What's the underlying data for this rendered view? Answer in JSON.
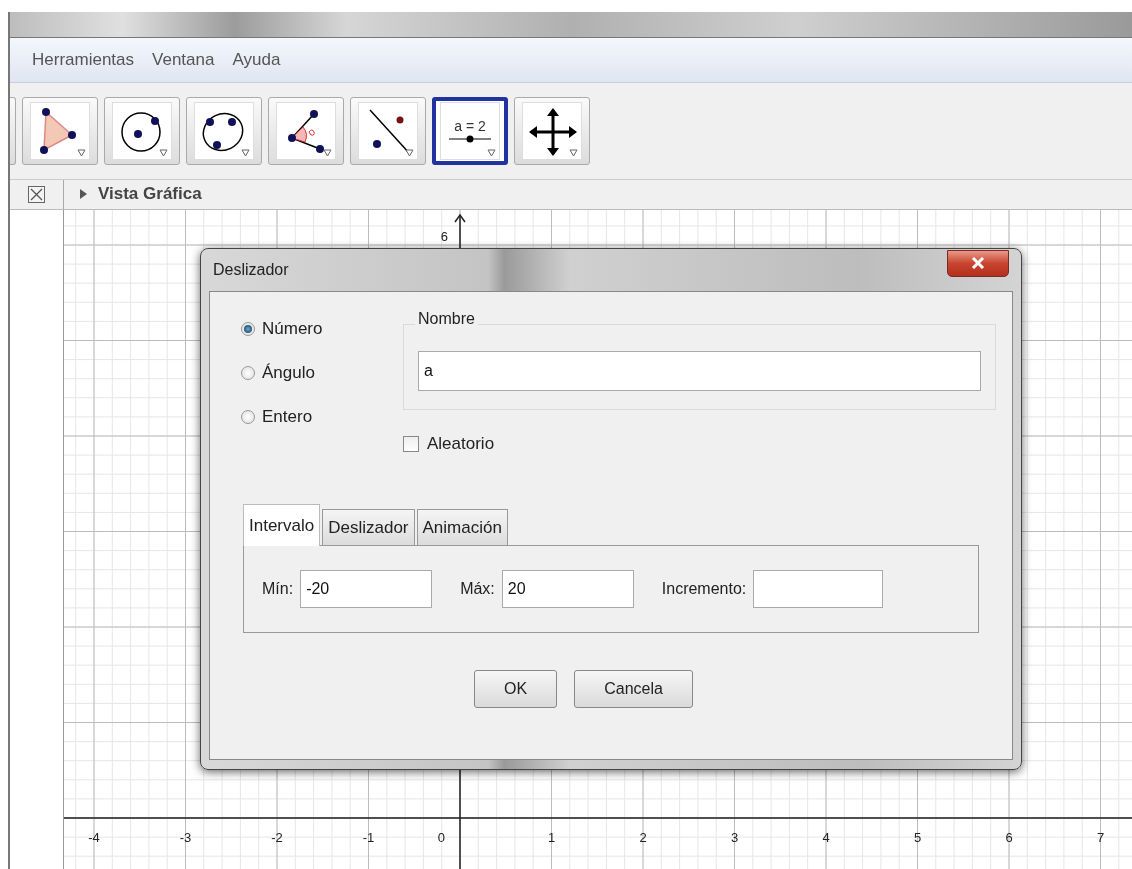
{
  "menu": [
    "Herramientas",
    "Ventana",
    "Ayuda"
  ],
  "tools": [
    {
      "kind": "cut",
      "selected": false
    },
    {
      "kind": "polygon",
      "selected": false
    },
    {
      "kind": "circle-center",
      "selected": false
    },
    {
      "kind": "circle-three",
      "selected": false
    },
    {
      "kind": "angle",
      "selected": false
    },
    {
      "kind": "line-point",
      "selected": false
    },
    {
      "kind": "slider",
      "selected": true,
      "label": "a = 2"
    },
    {
      "kind": "move",
      "selected": false
    }
  ],
  "view": {
    "title": "Vista Gráfica",
    "expanded": false
  },
  "graphics": {
    "x_labels": [
      "-4",
      "-3",
      "-2",
      "-1",
      "0",
      "1",
      "2",
      "3",
      "4",
      "5",
      "6",
      "7"
    ],
    "y_labels": [
      "6"
    ]
  },
  "dialog": {
    "title": "Deslizador",
    "types": [
      {
        "label": "Número",
        "selected": true
      },
      {
        "label": "Ángulo",
        "selected": false
      },
      {
        "label": "Entero",
        "selected": false
      }
    ],
    "name_group": {
      "label": "Nombre",
      "value": "a"
    },
    "random": {
      "label": "Aleatorio",
      "checked": false
    },
    "tabs": [
      {
        "label": "Intervalo",
        "selected": true
      },
      {
        "label": "Deslizador",
        "selected": false
      },
      {
        "label": "Animación",
        "selected": false
      }
    ],
    "fields": [
      {
        "label": "Mín:",
        "value": "-20"
      },
      {
        "label": "Máx:",
        "value": "20"
      },
      {
        "label": "Incremento:"
      }
    ],
    "buttons": [
      "OK",
      "Cancela"
    ]
  }
}
